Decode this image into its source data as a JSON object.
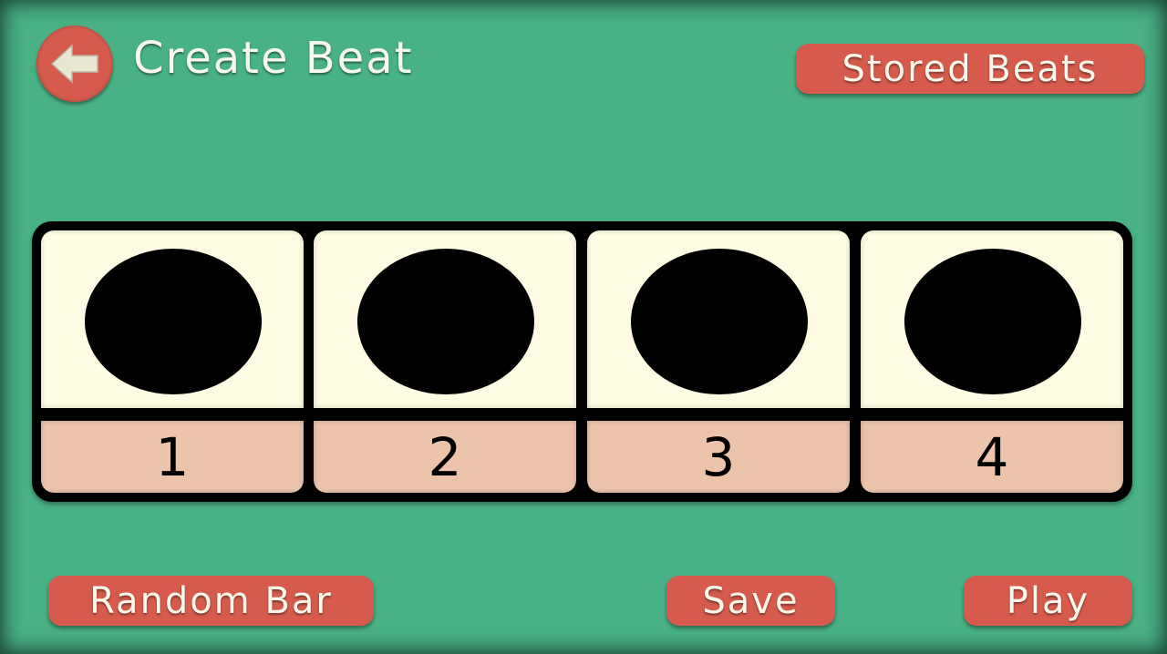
{
  "header": {
    "back_icon": "back-arrow-icon",
    "title": "Create Beat",
    "stored_beats_label": "Stored Beats"
  },
  "beats": [
    {
      "label": "1",
      "note": "filled-circle"
    },
    {
      "label": "2",
      "note": "filled-circle"
    },
    {
      "label": "3",
      "note": "filled-circle"
    },
    {
      "label": "4",
      "note": "filled-circle"
    }
  ],
  "footer": {
    "random_bar_label": "Random Bar",
    "save_label": "Save",
    "play_label": "Play"
  },
  "colors": {
    "background": "#49b186",
    "button": "#d65b4d",
    "button_text": "#f7f7ec",
    "pad": "#fdfce3",
    "label_strip": "#ebc4ab",
    "note": "#000000"
  }
}
